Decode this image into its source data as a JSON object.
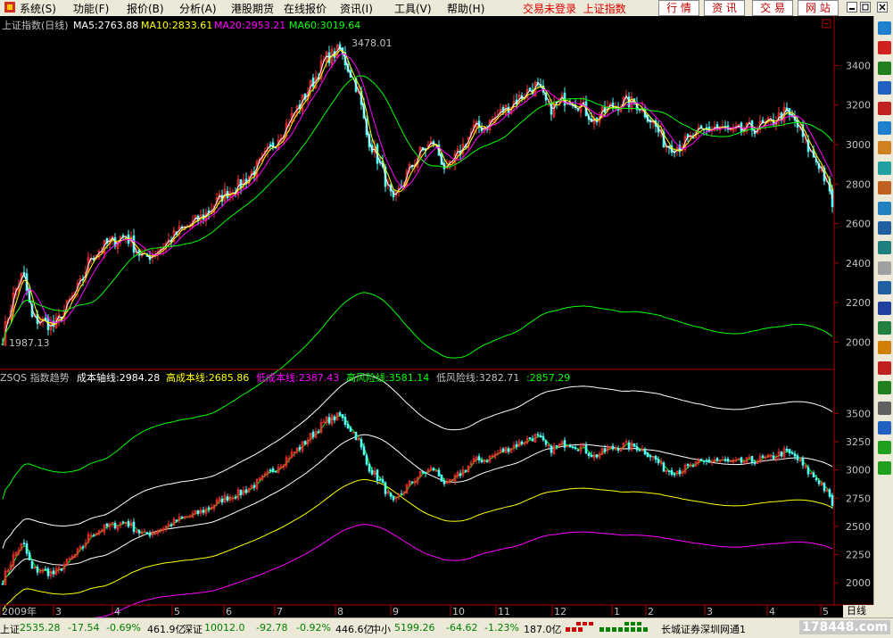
{
  "menu": {
    "items": [
      "系统(S)",
      "功能(F)",
      "报价(B)",
      "分析(A)",
      "港股期货",
      "在线报价",
      "资讯(I)",
      "工具(V)",
      "帮助(H)"
    ],
    "login_notice": "交易未登录",
    "index_name": "上证指数",
    "quick_buttons": [
      "行 情",
      "资 讯",
      "交 易",
      "网 站"
    ]
  },
  "colors": {
    "bg": "#000000",
    "up": "#ff3232",
    "down": "#54fcfc",
    "ma5": "#ffffff",
    "ma10": "#ffff00",
    "ma20": "#ff00ff",
    "ma60": "#00ff00",
    "grid_border": "#b00000",
    "axis_text": "#c0c0c0"
  },
  "main_panel": {
    "title": "上证指数(日线)",
    "ma_labels": [
      "MA5:2763.88",
      "MA10:2833.61",
      "MA20:2953.21",
      "MA60:3019.64"
    ],
    "high_label": "3478.01",
    "low_label": "1987.13",
    "y_ticks": [
      "3400",
      "3200",
      "3000",
      "2800",
      "2600",
      "2400",
      "2200",
      "2000"
    ]
  },
  "sub_panel": {
    "indicator_labels": [
      "ZSQS 指数趋势",
      "成本轴线:2984.28",
      "高成本线:2685.86",
      "低成本线:2387.43",
      "高风险线:3581.14",
      "低风险线:3282.71",
      ":2857.29"
    ],
    "y_ticks": [
      "3500",
      "3250",
      "3000",
      "2750",
      "2500",
      "2250",
      "2000"
    ]
  },
  "x_axis": {
    "labels": [
      "2009年",
      "3",
      "4",
      "5",
      "6",
      "7",
      "8",
      "9",
      "10",
      "11",
      "12",
      "1",
      "2",
      "3",
      "4",
      "5"
    ],
    "period_tab": "日线"
  },
  "status": {
    "sh_label": "上证",
    "sh_value": "2535.28",
    "sh_change": "-17.54",
    "sh_pct": "-0.69%",
    "sh_amount": "461.9亿",
    "sz_label": "深证",
    "sz_value": "10012.0",
    "sz_change": "-92.78",
    "sz_pct": "-0.92%",
    "sz_amount": "446.6亿",
    "zx_label": "中小",
    "zx_value": "5199.26",
    "zx_change": "-64.62",
    "zx_pct": "-1.23%",
    "zx_amount": "187.0亿",
    "broker": "长城证券深圳网通1",
    "watermark": "178448.com"
  },
  "chart_data": {
    "type": "candlestick",
    "title": "上证指数(日线)",
    "x_months": [
      "2009年",
      "3",
      "4",
      "5",
      "6",
      "7",
      "8",
      "9",
      "10",
      "11",
      "12",
      "1",
      "2",
      "3",
      "4",
      "5"
    ],
    "anchors": [
      [
        0,
        1987
      ],
      [
        15,
        2250
      ],
      [
        25,
        2350
      ],
      [
        35,
        2120
      ],
      [
        50,
        2100
      ],
      [
        60,
        2080
      ],
      [
        70,
        2150
      ],
      [
        90,
        2300
      ],
      [
        100,
        2430
      ],
      [
        120,
        2500
      ],
      [
        140,
        2540
      ],
      [
        160,
        2420
      ],
      [
        180,
        2480
      ],
      [
        200,
        2560
      ],
      [
        215,
        2600
      ],
      [
        230,
        2650
      ],
      [
        250,
        2750
      ],
      [
        270,
        2800
      ],
      [
        290,
        2900
      ],
      [
        305,
        3000
      ],
      [
        320,
        3100
      ],
      [
        335,
        3200
      ],
      [
        350,
        3320
      ],
      [
        365,
        3440
      ],
      [
        380,
        3478
      ],
      [
        390,
        3380
      ],
      [
        400,
        3280
      ],
      [
        410,
        3050
      ],
      [
        425,
        2900
      ],
      [
        440,
        2700
      ],
      [
        455,
        2850
      ],
      [
        470,
        2960
      ],
      [
        485,
        3010
      ],
      [
        500,
        2860
      ],
      [
        515,
        2970
      ],
      [
        530,
        3080
      ],
      [
        545,
        3100
      ],
      [
        565,
        3180
      ],
      [
        585,
        3250
      ],
      [
        600,
        3300
      ],
      [
        615,
        3180
      ],
      [
        635,
        3240
      ],
      [
        650,
        3200
      ],
      [
        665,
        3120
      ],
      [
        680,
        3180
      ],
      [
        700,
        3220
      ],
      [
        715,
        3200
      ],
      [
        730,
        3120
      ],
      [
        745,
        3000
      ],
      [
        760,
        2990
      ],
      [
        780,
        3050
      ],
      [
        800,
        3090
      ],
      [
        820,
        3060
      ],
      [
        840,
        3080
      ],
      [
        860,
        3100
      ],
      [
        878,
        3160
      ],
      [
        890,
        3120
      ],
      [
        905,
        2980
      ],
      [
        920,
        2880
      ],
      [
        935,
        2650
      ]
    ],
    "ma5_last": 2763.88,
    "ma10_last": 2833.61,
    "ma20_last": 2953.21,
    "ma60_last": 3019.64,
    "high": 3478.01,
    "low": 1987.13,
    "main_ylim": [
      1880,
      3560
    ],
    "sub_ylim": [
      1820,
      3700
    ],
    "sub_lines": {
      "cost_axis": 2984.28,
      "high_cost": 2685.86,
      "low_cost": 2387.43,
      "high_risk": 3581.14,
      "low_risk": 3282.71,
      "extra": 2857.29
    }
  }
}
